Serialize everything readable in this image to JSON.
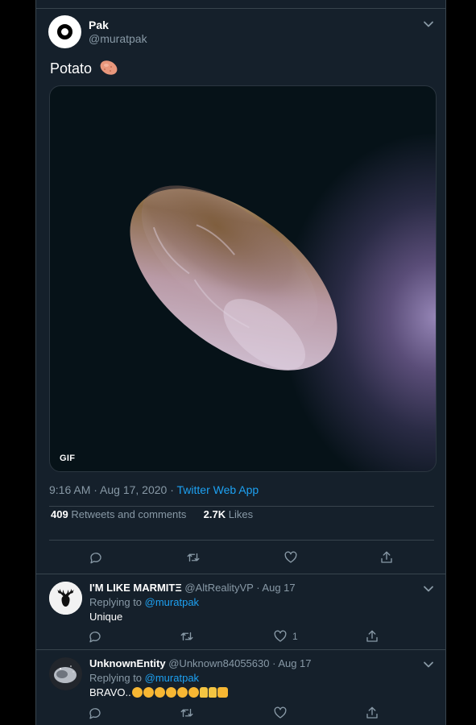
{
  "tweet": {
    "author_name": "Pak",
    "author_handle": "@muratpak",
    "text": "Potato",
    "emoji": "potato",
    "media_badge": "GIF",
    "time": "9:16 AM · Aug 17, 2020 · ",
    "app": "Twitter Web App",
    "retweets_count": "409",
    "retweets_label": "Retweets and comments",
    "likes_count": "2.7K",
    "likes_label": "Likes"
  },
  "replies": [
    {
      "name": "I'M LIKE MARMITΞ",
      "handle": "@AltRealityVP",
      "date": "· Aug 17",
      "replying_prefix": "Replying to ",
      "replying_to": "@muratpak",
      "text": "Unique",
      "like_count": "1"
    },
    {
      "name": "UnknownEntity",
      "handle": "@Unknown84055630",
      "date": "· Aug 17",
      "replying_prefix": "Replying to ",
      "replying_to": "@muratpak",
      "text": "BRAVO..",
      "emoji": [
        "clap",
        "clap",
        "clap",
        "clap",
        "clap",
        "clap",
        "thumbs-up",
        "thumbs-up",
        "fist"
      ]
    }
  ],
  "icons": [
    "reply-icon",
    "retweet-icon",
    "like-icon",
    "share-icon",
    "chevron-down-icon"
  ],
  "colors": {
    "background": "#15202b",
    "accent": "#1da1f2",
    "muted": "#8899a6",
    "border": "#38444d"
  }
}
